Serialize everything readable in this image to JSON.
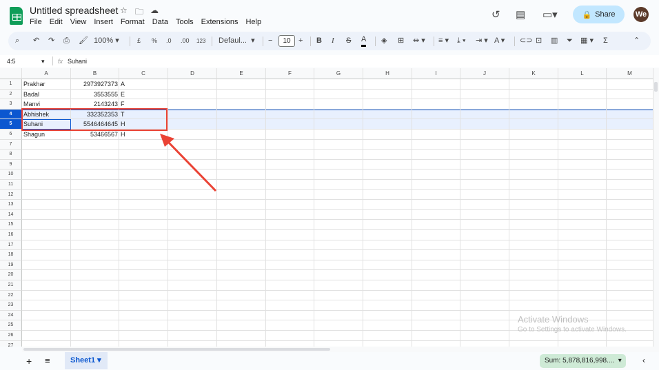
{
  "app": {
    "title": "Untitled spreadsheet",
    "menu": [
      "File",
      "Edit",
      "View",
      "Insert",
      "Format",
      "Data",
      "Tools",
      "Extensions",
      "Help"
    ],
    "share_label": "Share",
    "avatar_initials": "We"
  },
  "toolbar": {
    "zoom": "100%",
    "currency": "£",
    "percent": "%",
    "dec_decrease": ".0",
    "dec_increase": ".00",
    "number_format": "123",
    "font": "Defaul...",
    "font_size": "10",
    "bold": "B",
    "italic": "I",
    "sum": "Σ"
  },
  "formula_bar": {
    "name_box": "4:5",
    "fx": "fx",
    "value": "Suhani"
  },
  "columns": [
    "A",
    "B",
    "C",
    "D",
    "E",
    "F",
    "G",
    "H",
    "I",
    "J",
    "K",
    "L",
    "M"
  ],
  "rows": [
    "1",
    "2",
    "3",
    "4",
    "5",
    "6",
    "7",
    "8",
    "9",
    "10",
    "11",
    "12",
    "13",
    "14",
    "15",
    "16",
    "17",
    "18",
    "19",
    "20",
    "21",
    "22",
    "23",
    "24",
    "25",
    "26",
    "27"
  ],
  "selected_rows": [
    4,
    5
  ],
  "cells": [
    [
      "Prakhar",
      "2973927373",
      "A"
    ],
    [
      "Badal",
      "3553555",
      "E"
    ],
    [
      "Manvi",
      "2143243",
      "F"
    ],
    [
      "Abhishek",
      "332352353",
      "T"
    ],
    [
      "Suhani",
      "5546464645",
      "H"
    ],
    [
      "Shagun",
      "53466567",
      "H"
    ]
  ],
  "watermark": {
    "title": "Activate Windows",
    "subtitle": "Go to Settings to activate Windows."
  },
  "bottom": {
    "sheet_tab": "Sheet1",
    "sum": "Sum: 5,878,816,998...."
  },
  "colors": {
    "selection": "#0b57d0",
    "highlight": "#e8f0fe",
    "annotation": "#ea4335",
    "share_bg": "#c2e7ff",
    "sum_bg": "#ceead6"
  }
}
